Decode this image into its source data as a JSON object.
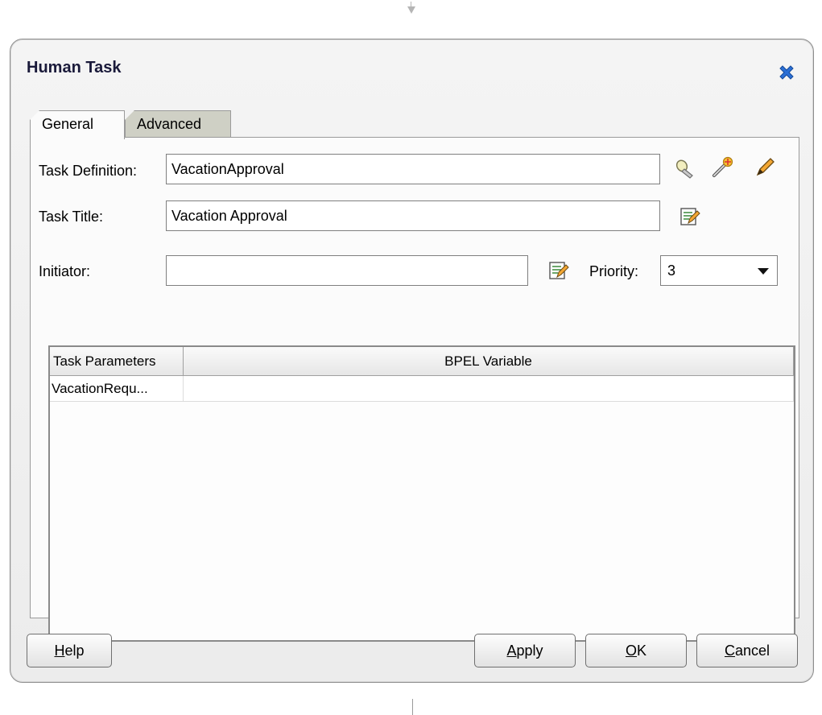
{
  "dialog": {
    "title": "Human Task",
    "close_icon": "close-x-icon",
    "accent_color": "#2a6fd6"
  },
  "tabs": [
    {
      "label": "General",
      "selected": true
    },
    {
      "label": "Advanced",
      "selected": false
    }
  ],
  "form": {
    "task_definition": {
      "label": "Task Definition:",
      "value": "VacationApproval",
      "icons": [
        "flashlight-icon",
        "magic-wand-icon",
        "pencil-icon"
      ]
    },
    "task_title": {
      "label": "Task Title:",
      "value": "Vacation Approval",
      "icon": "edit-expression-icon"
    },
    "initiator": {
      "label": "Initiator:",
      "value": "",
      "icon": "edit-expression-icon"
    },
    "priority": {
      "label": "Priority:",
      "value": "3"
    }
  },
  "table": {
    "columns": [
      "Task Parameters",
      "BPEL Variable"
    ],
    "rows": [
      {
        "param": "VacationRequ...",
        "variable": ""
      }
    ]
  },
  "buttons": {
    "help": {
      "mnemonic": "H",
      "rest": "elp"
    },
    "apply": {
      "mnemonic": "A",
      "rest": "pply"
    },
    "ok": {
      "mnemonic": "O",
      "rest": "K"
    },
    "cancel": {
      "mnemonic": "C",
      "rest": "ancel"
    }
  }
}
